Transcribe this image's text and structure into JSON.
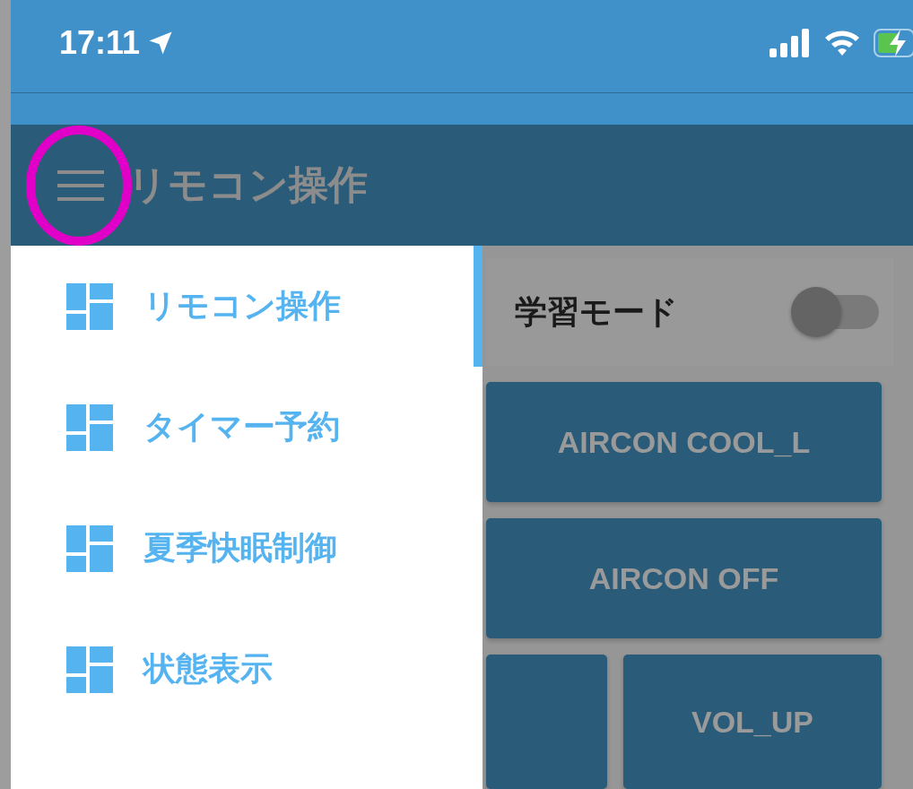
{
  "status_bar": {
    "time": "17:11"
  },
  "header": {
    "title": "リモコン操作"
  },
  "drawer": {
    "items": [
      {
        "label": "リモコン操作",
        "selected": true
      },
      {
        "label": "タイマー予約",
        "selected": false
      },
      {
        "label": "夏季快眠制御",
        "selected": false
      },
      {
        "label": "状態表示",
        "selected": false
      }
    ]
  },
  "content": {
    "learning_mode": {
      "label": "学習モード",
      "on": false
    },
    "buttons": [
      {
        "kind": "wide",
        "label": "AIRCON COOL_L"
      },
      {
        "kind": "wide",
        "label": "AIRCON OFF"
      },
      {
        "kind": "narrow"
      },
      {
        "kind": "medium",
        "label": "VOL_UP"
      }
    ]
  }
}
